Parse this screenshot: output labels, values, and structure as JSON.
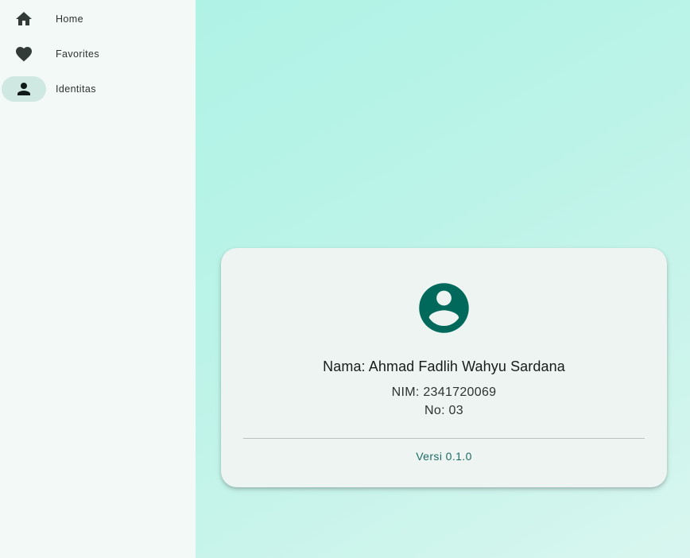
{
  "sidebar": {
    "items": [
      {
        "label": "Home",
        "icon": "home-icon",
        "active": false
      },
      {
        "label": "Favorites",
        "icon": "heart-icon",
        "active": false
      },
      {
        "label": "Identitas",
        "icon": "person-icon",
        "active": true
      }
    ]
  },
  "profile": {
    "avatar_icon": "account-circle-icon",
    "name": "Nama: Ahmad Fadlih Wahyu Sardana",
    "nim": "NIM: 2341720069",
    "no": "No: 03",
    "version": "Versi 0.1.0"
  },
  "colors": {
    "primary": "#00695c",
    "background_gradient_start": "#aff3e6",
    "background_gradient_end": "#d8f6ef",
    "sidebar_bg": "#f3f9f7",
    "active_indicator": "#cfe8e2",
    "card_bg": "#edf4f2"
  }
}
